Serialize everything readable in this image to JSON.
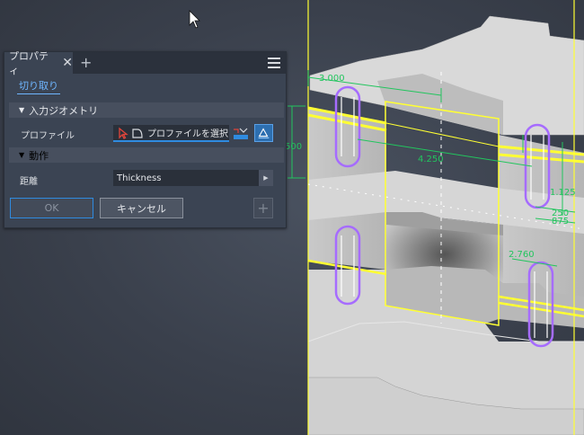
{
  "panel": {
    "tab_label": "プロパティ",
    "tab_close": "✕",
    "add_tab": "+",
    "cut_link": "切り取り",
    "input_geometry_title": "入力ジオメトリ",
    "profile_label": "プロファイル",
    "profile_button": "プロファイルを選択",
    "behavior_title": "動作",
    "distance_label": "距離",
    "distance_value": "Thickness",
    "ok_label": "OK",
    "cancel_label": "キャンセル",
    "add_label": "+"
  },
  "dimensions": {
    "d1": "3.000",
    "d2": "500",
    "d3": "4.250",
    "d4": "1.125",
    "d5": "250",
    "d6": "875",
    "d7": "2.760"
  },
  "colors": {
    "accent": "#2f8be0",
    "dimension": "#22c55e",
    "profile_outline": "#ffff33",
    "slot": "#a66cff"
  },
  "icons": {
    "cursor": "arrow-cursor-icon",
    "menu": "hamburger-menu-icon",
    "select": "select-arrow-icon",
    "profile": "profile-shape-icon"
  }
}
